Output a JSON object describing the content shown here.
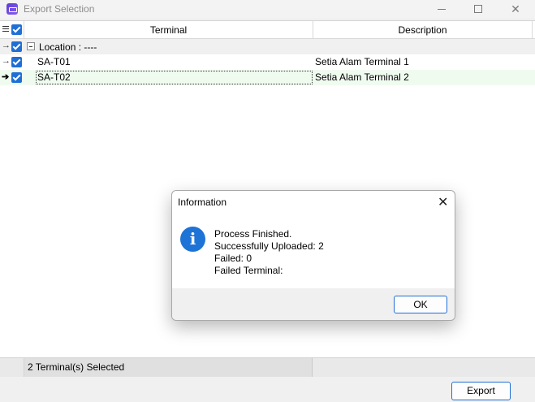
{
  "window": {
    "title": "Export Selection",
    "app_icon": "app-icon"
  },
  "grid": {
    "columns": [
      "Terminal",
      "Description"
    ],
    "group": {
      "label": "Location : ----",
      "checked": true
    },
    "rows": [
      {
        "terminal": "SA-T01",
        "description": "Setia Alam Terminal 1",
        "checked": true
      },
      {
        "terminal": "SA-T02",
        "description": "Setia Alam Terminal 2",
        "checked": true,
        "current": true
      }
    ],
    "status_text": "2 Terminal(s) Selected"
  },
  "footer": {
    "export_label": "Export"
  },
  "dialog": {
    "title": "Information",
    "icon": "info-icon",
    "message_lines": [
      "Process Finished.",
      "Successfully Uploaded: 2",
      "Failed: 0",
      "Failed Terminal:"
    ],
    "ok_label": "OK"
  },
  "colors": {
    "accent": "#1f6fd6",
    "info_icon": "#1e73d6",
    "selected_row": "#f0fbf0"
  }
}
